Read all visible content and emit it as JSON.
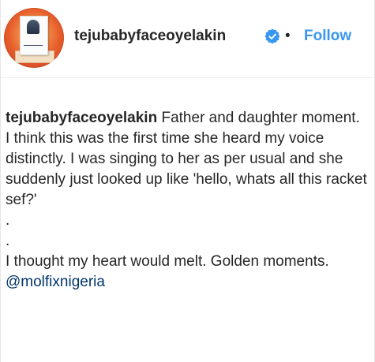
{
  "header": {
    "username": "tejubabyfaceoyelakin",
    "separator": "•",
    "follow_label": "Follow"
  },
  "caption": {
    "author": "tejubabyfaceoyelakin",
    "paragraph1": "Father and daughter moment. I think this was the first time she heard my voice distinctly. I was singing to her as per usual and she suddenly just looked up like 'hello, whats all this racket sef?'",
    "dot1": ".",
    "dot2": ".",
    "paragraph2": "I thought my heart would melt. Golden moments.",
    "mention": "@molfixnigeria"
  },
  "colors": {
    "link": "#3897f0",
    "mention": "#003569",
    "verified": "#3897f0",
    "text": "#262626"
  },
  "icons": {
    "verified": "verified-badge-icon",
    "avatar": "profile-avatar"
  }
}
